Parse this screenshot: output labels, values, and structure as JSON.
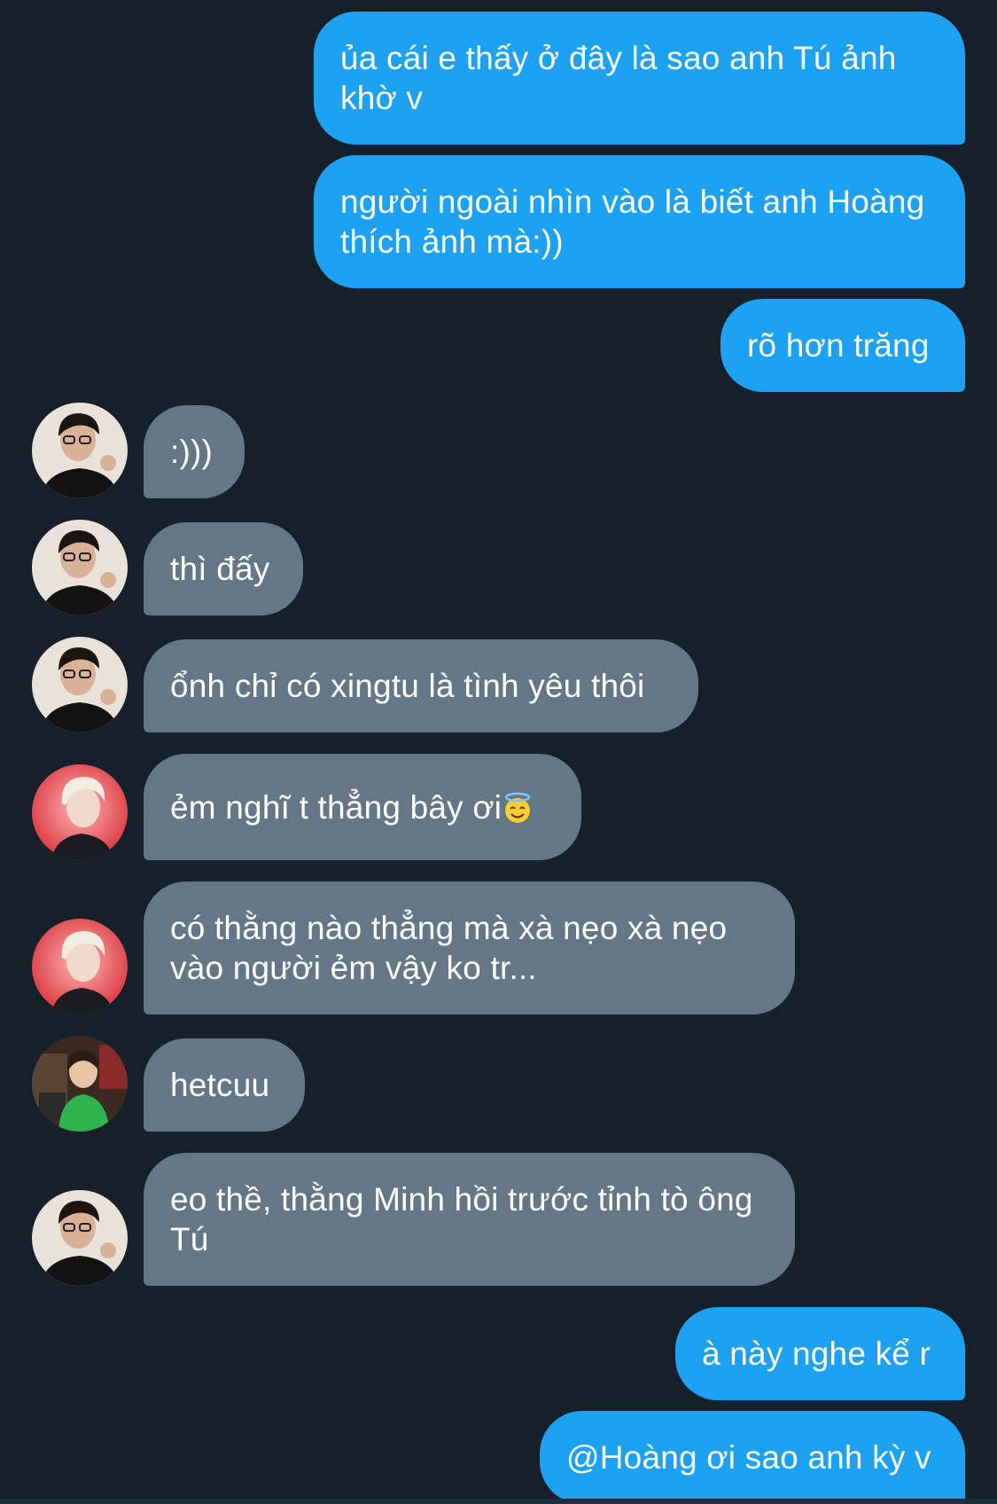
{
  "messages": [
    {
      "side": "out",
      "text": "ủa cái e thấy ở đây là sao anh Tú ảnh khờ v"
    },
    {
      "side": "out",
      "text": "người ngoài nhìn vào là biết anh Hoàng thích ảnh mà:))"
    },
    {
      "side": "out",
      "text": "rõ hơn trăng"
    },
    {
      "side": "in",
      "avatar": "glasses-man-avatar",
      "text": ":)))"
    },
    {
      "side": "in",
      "avatar": "glasses-man-avatar",
      "text": "thì đấy"
    },
    {
      "side": "in",
      "avatar": "glasses-man-avatar",
      "text": "ổnh chỉ có xingtu là tình yêu thôi"
    },
    {
      "side": "in",
      "avatar": "blond-man-avatar",
      "text": "ẻm nghĩ t thẳng bây ơi",
      "emoji": "smiling-face-with-halo-emoji"
    },
    {
      "side": "in",
      "avatar": "blond-man-avatar",
      "text": "có thằng nào thẳng mà xà nẹo xà nẹo vào người ẻm vậy ko tr..."
    },
    {
      "side": "in",
      "avatar": "green-shirt-avatar",
      "text": "hetcuu"
    },
    {
      "side": "in",
      "avatar": "glasses-man-avatar",
      "text": "eo thề, thằng Minh hồi trước tỉnh tò ông Tú"
    },
    {
      "side": "out",
      "text": "à này nghe kể r"
    },
    {
      "side": "out",
      "text": "@Hoàng ơi sao anh kỳ v"
    }
  ],
  "colors": {
    "background": "#15202b",
    "outgoing_bubble": "#1da1f2",
    "incoming_bubble": "#657786",
    "text": "#ffffff"
  }
}
